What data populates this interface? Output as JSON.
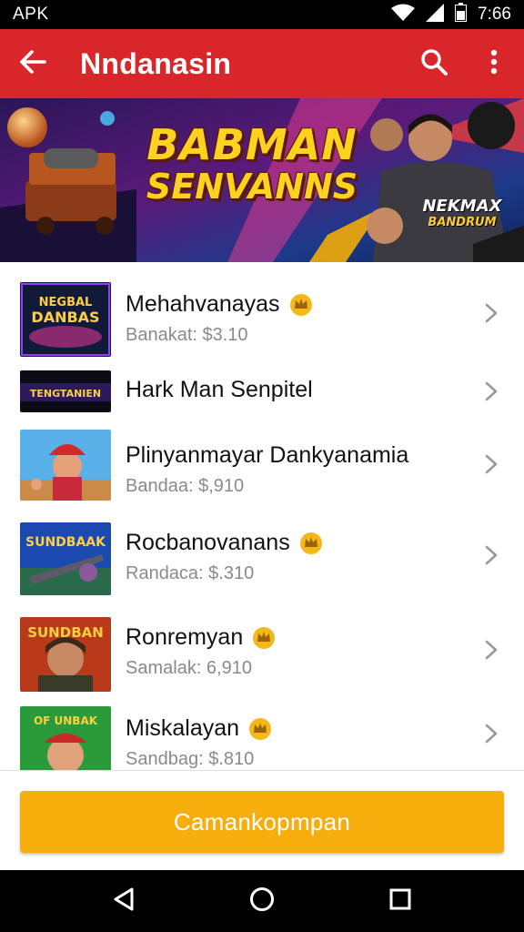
{
  "status_bar": {
    "left_label": "APK",
    "time": "7:66",
    "icons": [
      "wifi-icon",
      "signal-icon",
      "battery-icon"
    ]
  },
  "app_bar": {
    "title": "Nndanasin",
    "back_icon": "arrow-left-icon",
    "search_icon": "search-icon",
    "menu_icon": "more-vert-icon",
    "color": "#d9262b"
  },
  "banner": {
    "title_line1": "BABMAN",
    "title_line2": "SENVANNS",
    "badge_line1": "NEKMAX",
    "badge_line2": "BANDRUM"
  },
  "games": [
    {
      "title": "Mehahvanayas",
      "subtitle": "Banakat: $3.10",
      "has_crown": true,
      "thumb_text_1": "NEGBAL",
      "thumb_text_2": "DANBAS"
    },
    {
      "title": "Hark Man Senpitel",
      "subtitle": "",
      "has_crown": false,
      "thumb_text_1": "",
      "thumb_text_2": "TENGTANIEN"
    },
    {
      "title": "Plinyanmayar Dankyanamia",
      "subtitle": "Bandaa: $,910",
      "has_crown": false
    },
    {
      "title": "Rocbanovanans",
      "subtitle": "Randaca: $.310",
      "has_crown": true,
      "thumb_text_1": "SUNDBAAK"
    },
    {
      "title": "Ronremyan",
      "subtitle": "Samalak: 6,910",
      "has_crown": true,
      "thumb_text_1": "SUNDBAN"
    },
    {
      "title": "Miskalayan",
      "subtitle": "Sandbag: $.810",
      "has_crown": true,
      "thumb_text_1": "OF UNBAK"
    }
  ],
  "cta": {
    "label": "Camankopmpan",
    "color": "#f5ae0c"
  },
  "nav_bar": {
    "icons": [
      "back-triangle-icon",
      "home-circle-icon",
      "recents-square-icon"
    ]
  }
}
